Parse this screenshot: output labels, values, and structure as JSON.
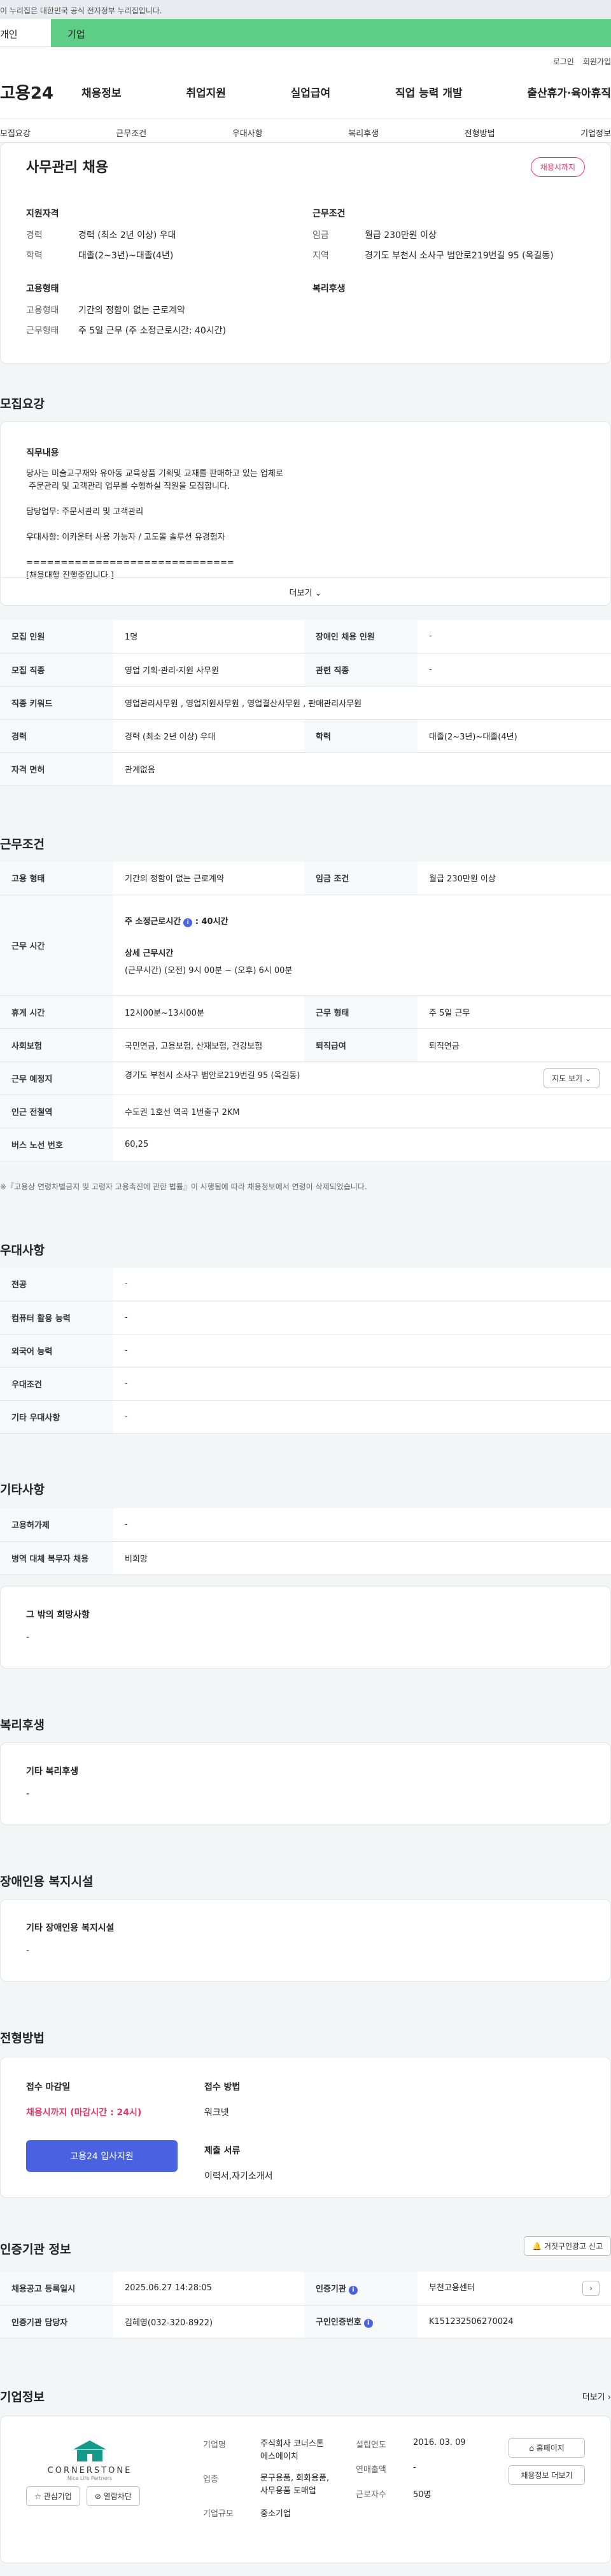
{
  "gov_banner": "이 누리집은 대한민국 공식 전자정부 누리집입니다.",
  "top_tabs": {
    "personal": "개인",
    "corporate": "기업"
  },
  "util": {
    "login": "로그인",
    "join": "회원가입"
  },
  "logo": "고용24",
  "gnb": [
    "채용정보",
    "취업지원",
    "실업급여",
    "직업 능력 개발",
    "출산휴가·육아휴직"
  ],
  "subnav": [
    "모집요강",
    "근무조건",
    "우대사항",
    "복리후생",
    "전형방법",
    "기업정보"
  ],
  "summary": {
    "title": "사무관리 채용",
    "badge": "채용시까지",
    "qual_head": "지원자격",
    "career_k": "경력",
    "career_v": "경력 (최소 2년 이상) 우대",
    "edu_k": "학력",
    "edu_v": "대졸(2~3년)~대졸(4년)",
    "cond_head": "근무조건",
    "wage_k": "임금",
    "wage_v": "월급 230만원 이상",
    "region_k": "지역",
    "region_v": "경기도 부천시 소사구 범안로219번길 95 (옥길동)",
    "emp_head": "고용형태",
    "emptype_k": "고용형태",
    "emptype_v": "기간의 정함이 없는 근로계약",
    "worktype_k": "근무형태",
    "worktype_v": "주 5일 근무 (주 소정근로시간: 40시간)",
    "welfare_head": "복리후생"
  },
  "recruit": {
    "title": "모집요강",
    "duty_label": "직무내용",
    "duty_lines": [
      "당사는 미술교구재와 유아동 교육상품 기획및 교재를 판매하고 있는 업체로",
      " 주문관리 및 고객관리 업무를 수행하실 직원을 모집합니다.",
      "",
      "담당업무: 주문서관리 및 고객관리",
      "",
      "우대사항: 이카운터 사용 가능자 / 고도몰 솔루션 유경험자",
      "",
      "==============================",
      "[채용대행 진행중입니다.]"
    ],
    "more": "더보기",
    "rows": [
      [
        "모집 인원",
        "1명",
        "장애인 채용 인원",
        "-"
      ],
      [
        "모집 직종",
        "영업 기획·관리·지원 사무원",
        "관련 직종",
        "-"
      ],
      [
        "직종 키워드",
        "영업관리사무원 , 영업지원사무원 , 영업결산사무원 , 판매관리사무원",
        "",
        ""
      ],
      [
        "경력",
        "경력 (최소 2년 이상) 우대",
        "학력",
        "대졸(2~3년)~대졸(4년)"
      ],
      [
        "자격 면허",
        "관계없음",
        "",
        ""
      ]
    ]
  },
  "work": {
    "title": "근무조건",
    "emp_k": "고용 형태",
    "emp_v": "기간의 정함이 없는 근로계약",
    "wage_k": "임금 조건",
    "wage_v": "월급 230만원 이상",
    "time_k": "근무 시간",
    "hours_label": "주 소정근로시간",
    "hours_v": ": 40시간",
    "detail_label": "상세 근무시간",
    "detail_v": "(근무시간) (오전) 9시 00분 ~ (오후) 6시 00분",
    "break_k": "휴게 시간",
    "break_v": "12시00분~13시00분",
    "form_k": "근무 형태",
    "form_v": "주 5일 근무",
    "ins_k": "사회보험",
    "ins_v": "국민연금, 고용보험, 산재보험, 건강보험",
    "sev_k": "퇴직급여",
    "sev_v": "퇴직연금",
    "place_k": "근무 예정지",
    "place_v": "경기도 부천시 소사구 범안로219번길 95 (옥길동)",
    "map_btn": "지도 보기",
    "subway_k": "인근 전철역",
    "subway_v": "수도권 1호선 역곡 1번출구 2KM",
    "bus_k": "버스 노선 번호",
    "bus_v": "60,25",
    "note": "※『고용상 연령차별금지 및 고령자 고용촉진에 관한 법률』이 시행됨에 따라 채용정보에서 연령이 삭제되었습니다."
  },
  "pref": {
    "title": "우대사항",
    "rows": [
      [
        "전공",
        "-"
      ],
      [
        "컴퓨터 활용 능력",
        "-"
      ],
      [
        "외국어 능력",
        "-"
      ],
      [
        "우대조건",
        "-"
      ],
      [
        "기타 우대사항",
        "-"
      ]
    ]
  },
  "etc": {
    "title": "기타사항",
    "rows": [
      [
        "고용허가제",
        "-"
      ],
      [
        "병역 대체 복무자 채용",
        "비희망"
      ]
    ],
    "other_label": "그 밖의 희망사항",
    "other_v": "-"
  },
  "welfare": {
    "title": "복리후생",
    "label": "기타 복리후생",
    "v": "-"
  },
  "disab": {
    "title": "장애인용 복지시설",
    "label": "기타 장애인용 복지시설",
    "v": "-"
  },
  "process": {
    "title": "전형방법",
    "deadline_label": "접수 마감일",
    "deadline_v": "채용시까지 (마감시간 : 24시)",
    "apply_btn": "고용24 입사지원",
    "method_label": "접수 방법",
    "method_v": "워크넷",
    "docs_label": "제출 서류",
    "docs_v": "이력서,자기소개서"
  },
  "cert": {
    "title": "인증기관 정보",
    "report_btn": "거짓구인광고 신고",
    "reg_k": "채용공고 등록일시",
    "reg_v": "2025.06.27 14:28:05",
    "org_k": "인증기관",
    "org_v": "부천고용센터",
    "mgr_k": "인증기관 담당자",
    "mgr_v": "김혜영(032-320-8922)",
    "num_k": "구인인증번호",
    "num_v": "K151232506270024"
  },
  "company": {
    "title": "기업정보",
    "more": "더보기",
    "logo_text": "CORNERSTONE",
    "logo_sub": "Nice Life Partners",
    "interest_btn": "관심기업",
    "block_btn": "열람차단",
    "name_k": "기업명",
    "name_v": "주식회사 코너스톤에스에이치",
    "ind_k": "업종",
    "ind_v": "문구용품, 회화용품, 사무용품 도매업",
    "size_k": "기업규모",
    "size_v": "중소기업",
    "year_k": "설립연도",
    "year_v": "2016. 03. 09",
    "sales_k": "연매출액",
    "sales_v": "-",
    "emp_k": "근로자수",
    "emp_v": "50명",
    "home_btn": "홈페이지",
    "jobs_btn": "채용정보 더보기"
  }
}
